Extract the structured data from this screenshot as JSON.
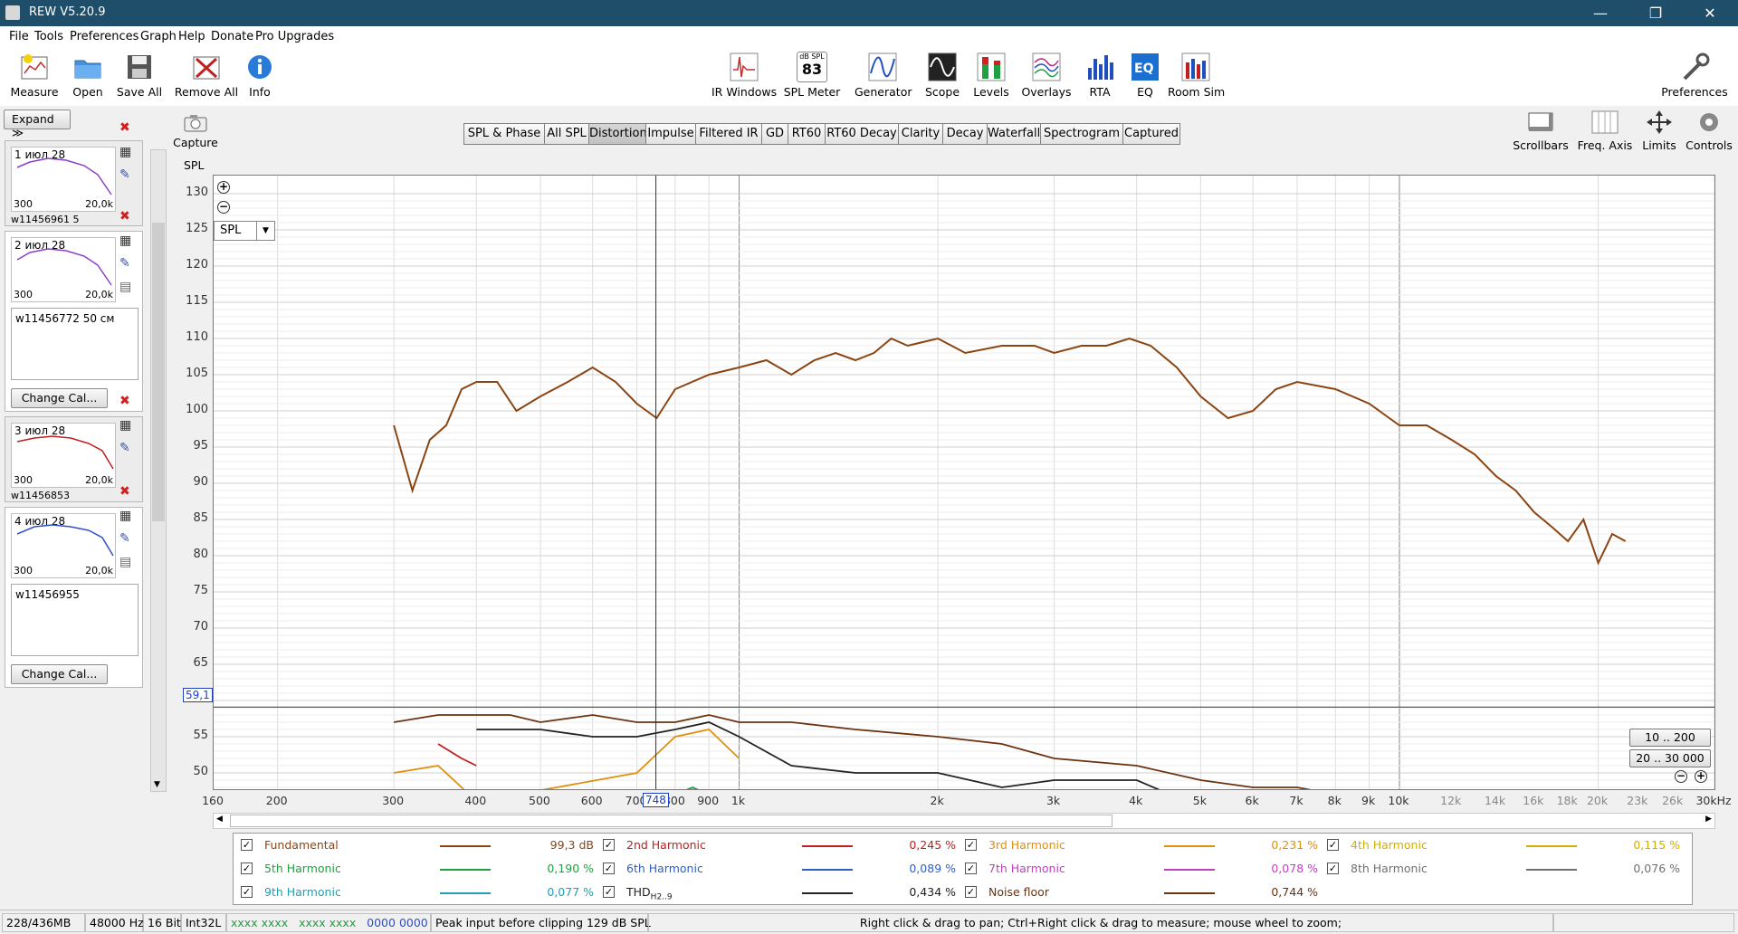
{
  "window": {
    "title": "REW V5.20.9",
    "minimize": "—",
    "restore": "❐",
    "close": "✕"
  },
  "menu": [
    "File",
    "Tools",
    "Preferences",
    "Graph",
    "Help",
    "Donate",
    "Pro Upgrades"
  ],
  "toolbar_left": [
    "Measure",
    "Open",
    "Save All",
    "Remove All",
    "Info"
  ],
  "toolbar_center": [
    "IR Windows",
    "SPL Meter",
    "Generator",
    "Scope",
    "Levels",
    "Overlays",
    "RTA",
    "EQ",
    "Room Sim"
  ],
  "spl_meter_icon": {
    "top": "dB SPL",
    "value": "83"
  },
  "toolbar_right": {
    "preferences": "Preferences"
  },
  "left_panel": {
    "expand": "Expand ≫",
    "capture": "Capture",
    "measurements": [
      {
        "title": "1 июл 28",
        "x_from": "300",
        "x_to": "20,0k",
        "color": "#8a3fc8",
        "notes": "w11456961 5"
      },
      {
        "title": "2 июл 28",
        "x_from": "300",
        "x_to": "20,0k",
        "color": "#8a3fc8",
        "notes": "w11456772 50 см",
        "change_cal": "Change Cal..."
      },
      {
        "title": "3 июл 28",
        "x_from": "300",
        "x_to": "20,0k",
        "color": "#c02020",
        "notes": "w11456853"
      },
      {
        "title": "4 июл 28",
        "x_from": "300",
        "x_to": "20,0k",
        "color": "#3050d0",
        "notes": "w11456955",
        "change_cal": "Change Cal..."
      }
    ]
  },
  "tabs": [
    "SPL & Phase",
    "All SPL",
    "Distortion",
    "Impulse",
    "Filtered IR",
    "GD",
    "RT60",
    "RT60 Decay",
    "Clarity",
    "Decay",
    "Waterfall",
    "Spectrogram",
    "Captured"
  ],
  "active_tab": "Distortion",
  "right_tools": [
    "Scrollbars",
    "Freq. Axis",
    "Limits",
    "Controls"
  ],
  "graph": {
    "y_title": "SPL",
    "y_ticks": [
      "130",
      "125",
      "120",
      "115",
      "110",
      "105",
      "100",
      "95",
      "90",
      "85",
      "80",
      "75",
      "70",
      "65",
      "60",
      "55",
      "50"
    ],
    "x_ticks": [
      "160",
      "200",
      "300",
      "400",
      "500",
      "600",
      "700",
      "800",
      "900",
      "1k",
      "2k",
      "3k",
      "4k",
      "5k",
      "6k",
      "7k",
      "8k",
      "9k",
      "10k",
      "12k",
      "14k",
      "16k",
      "18k",
      "20k",
      "23k",
      "26k",
      "30kHz"
    ],
    "selector": "SPL",
    "cursor_y_label": "59,1",
    "cursor_x_label": "748",
    "zoom_buttons": [
      "10 .. 200",
      "20 .. 30 000"
    ]
  },
  "chart_data": {
    "type": "line",
    "xlabel": "",
    "ylabel": "SPL",
    "x_scale": "log",
    "xlim": [
      160,
      30000
    ],
    "ylim": [
      46,
      132
    ],
    "grid": true,
    "series": [
      {
        "name": "Fundamental",
        "color": "#8b4513",
        "x": [
          300,
          320,
          340,
          360,
          380,
          400,
          430,
          460,
          500,
          550,
          600,
          650,
          700,
          750,
          800,
          900,
          1000,
          1100,
          1200,
          1300,
          1400,
          1500,
          1600,
          1700,
          1800,
          2000,
          2200,
          2500,
          2800,
          3000,
          3300,
          3600,
          3900,
          4200,
          4600,
          5000,
          5500,
          6000,
          6500,
          7000,
          8000,
          9000,
          10000,
          11000,
          12000,
          13000,
          14000,
          15000,
          16000,
          17000,
          18000,
          19000,
          20000,
          21000,
          22000
        ],
        "y": [
          98,
          89,
          96,
          98,
          103,
          104,
          104,
          100,
          102,
          104,
          106,
          104,
          101,
          99,
          103,
          105,
          106,
          107,
          105,
          107,
          108,
          107,
          108,
          110,
          109,
          110,
          108,
          109,
          109,
          108,
          109,
          109,
          110,
          109,
          106,
          102,
          99,
          100,
          103,
          104,
          103,
          101,
          98,
          98,
          96,
          94,
          91,
          89,
          86,
          84,
          82,
          85,
          79,
          83,
          82
        ]
      },
      {
        "name": "Noise floor",
        "color": "#6b3310",
        "x": [
          300,
          350,
          400,
          450,
          500,
          600,
          700,
          800,
          900,
          1000,
          1200,
          1500,
          2000,
          2500,
          3000,
          4000,
          5000,
          6000,
          7000,
          8000,
          10000,
          12000,
          15000
        ],
        "y": [
          57,
          58,
          58,
          58,
          57,
          58,
          57,
          57,
          58,
          57,
          57,
          56,
          55,
          54,
          52,
          51,
          49,
          48,
          48,
          47,
          47,
          46,
          46
        ]
      },
      {
        "name": "THD",
        "color": "#222222",
        "x": [
          400,
          500,
          600,
          700,
          800,
          900,
          1000,
          1200,
          1500,
          2000,
          2500,
          3000,
          4000,
          4500
        ],
        "y": [
          56,
          56,
          55,
          55,
          56,
          57,
          55,
          51,
          50,
          50,
          48,
          49,
          49,
          47
        ]
      },
      {
        "name": "3rd Harmonic",
        "color": "#e09010",
        "x": [
          300,
          350,
          380,
          400,
          700,
          800,
          900,
          1000
        ],
        "y": [
          50,
          51,
          48,
          46,
          50,
          55,
          56,
          52
        ]
      },
      {
        "name": "2nd Harmonic",
        "color": "#c02020",
        "x": [
          350,
          380,
          400
        ],
        "y": [
          54,
          52,
          51
        ]
      },
      {
        "name": "5th Harmonic",
        "color": "#20a040",
        "x": [
          700,
          750,
          800,
          850,
          900
        ],
        "y": [
          46,
          47,
          47,
          48,
          47
        ]
      }
    ]
  },
  "legend": [
    {
      "name": "Fundamental",
      "color": "#8b4513",
      "value": "99,3 dB",
      "checked": true
    },
    {
      "name": "2nd Harmonic",
      "color": "#c02020",
      "value": "0,245 %",
      "checked": true
    },
    {
      "name": "3rd Harmonic",
      "color": "#e09010",
      "value": "0,231 %",
      "checked": true
    },
    {
      "name": "4th Harmonic",
      "color": "#d0b000",
      "value": "0,115 %",
      "checked": true
    },
    {
      "name": "5th Harmonic",
      "color": "#20a040",
      "value": "0,190 %",
      "checked": true
    },
    {
      "name": "6th Harmonic",
      "color": "#3060c0",
      "value": "0,089 %",
      "checked": true
    },
    {
      "name": "7th Harmonic",
      "color": "#c040c0",
      "value": "0,078 %",
      "checked": true
    },
    {
      "name": "8th Harmonic",
      "color": "#707070",
      "value": "0,076 %",
      "checked": true
    },
    {
      "name": "9th Harmonic",
      "color": "#20a0b0",
      "value": "0,077 %",
      "checked": true
    },
    {
      "name": "THD",
      "sub": "H2..9",
      "color": "#222222",
      "value": "0,434 %",
      "checked": true
    },
    {
      "name": "Noise floor",
      "color": "#6b3310",
      "value": "0,744 %",
      "checked": true
    }
  ],
  "status": {
    "memory": "228/436MB",
    "rate": "48000 Hz",
    "bits": "16 Bit",
    "format": "Int32L",
    "meters_a": "xxxx xxxx",
    "meters_b": "xxxx xxxx",
    "meters_c": "0000 0000",
    "peak": "Peak input before clipping 129 dB SPL",
    "hint": "Right click & drag to pan; Ctrl+Right click & drag to measure; mouse wheel to zoom;"
  }
}
